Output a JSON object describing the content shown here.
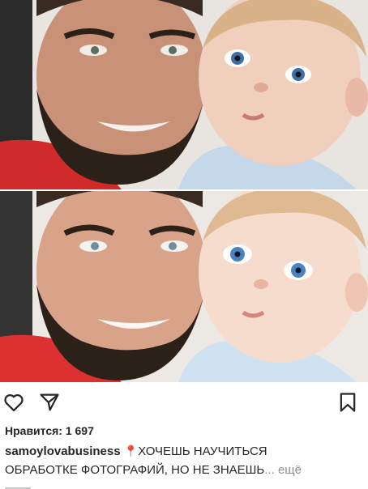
{
  "post": {
    "photos": [
      {
        "variant": "original"
      },
      {
        "variant": "retouched"
      }
    ],
    "actions": {
      "like_icon": "heart-outline-icon",
      "share_icon": "paper-plane-icon",
      "save_icon": "bookmark-outline-icon"
    },
    "likes_label": "Нравится: 1 697",
    "caption": {
      "username": "samoylovabusiness",
      "pin_glyph": "📍",
      "text_line1": "ХОЧЕШЬ НАУЧИТЬСЯ",
      "text_line2": "ОБРАБОТКЕ ФОТОГРАФИЙ, НО НЕ ЗНАЕШЬ",
      "ellipsis": "...",
      "more_label": "ещё"
    }
  },
  "colors": {
    "text": "#262626",
    "muted": "#8e8e8e",
    "background": "#ffffff",
    "pin": "#d62828"
  }
}
